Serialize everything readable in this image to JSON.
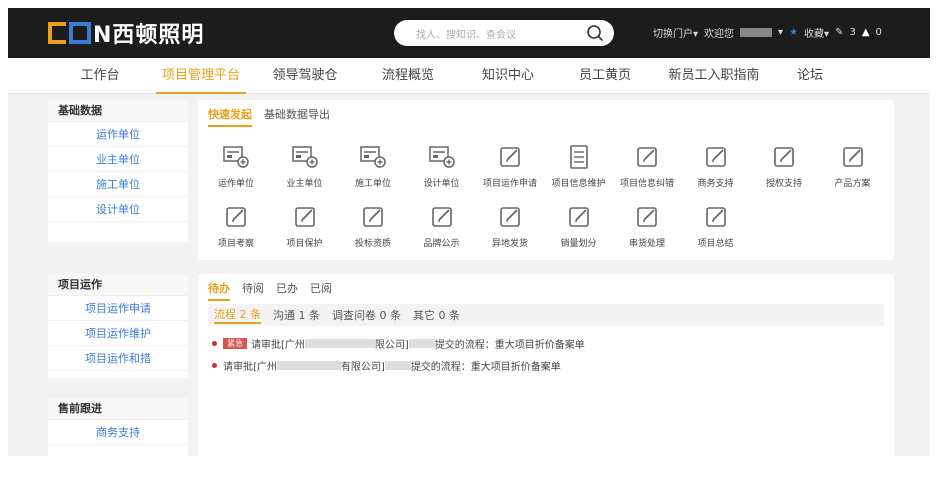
{
  "header": {
    "logo_text": "N西顿照明",
    "search_placeholder": "找人、搜知识、查会议",
    "switch_portal": "切换门户▾",
    "welcome": "欢迎您",
    "favorites": "收藏▾",
    "msg_count": "3",
    "alert_count": "0",
    "accent": "#e8a11c"
  },
  "nav": {
    "items": [
      "工作台",
      "项目管理平台",
      "领导驾驶仓",
      "流程概览",
      "知识中心",
      "员工黄页",
      "新员工入职指南",
      "论坛"
    ],
    "active_index": 1
  },
  "sidebar": {
    "basic": {
      "title": "基础数据",
      "links": [
        "运作单位",
        "业主单位",
        "施工单位",
        "设计单位"
      ]
    },
    "ops": {
      "title": "项目运作",
      "links": [
        "项目运作申请",
        "项目运作维护",
        "项目运作和措"
      ]
    },
    "presale": {
      "title": "售前跟进",
      "links": [
        "商务支持"
      ]
    }
  },
  "quick": {
    "tabs": [
      "快速发起",
      "基础数据导出"
    ],
    "row1": [
      "运作单位",
      "业主单位",
      "施工单位",
      "设计单位",
      "项目运作申请",
      "项目信息维护",
      "项目信息纠错",
      "商务支持",
      "授权支持",
      "产品方案"
    ],
    "row2": [
      "项目考察",
      "项目保护",
      "投标资质",
      "品牌公示",
      "异地发货",
      "销量划分",
      "串货处理",
      "项目总结"
    ]
  },
  "todo": {
    "tabs": [
      "待办",
      "待阅",
      "已办",
      "已阅"
    ],
    "subtabs": [
      "流程 2 条",
      "沟通 1 条",
      "调查问卷 0 条",
      "其它 0 条"
    ],
    "urgent_badge": "紧急",
    "items": [
      {
        "prefix": "请审批[广州",
        "mid": "限公司]",
        "suffix": "提交的流程：重大项目折价备案单"
      },
      {
        "prefix": "请审批[广州",
        "mid": "有限公司]",
        "suffix": "提交的流程：重大项目折价备案单"
      }
    ]
  }
}
